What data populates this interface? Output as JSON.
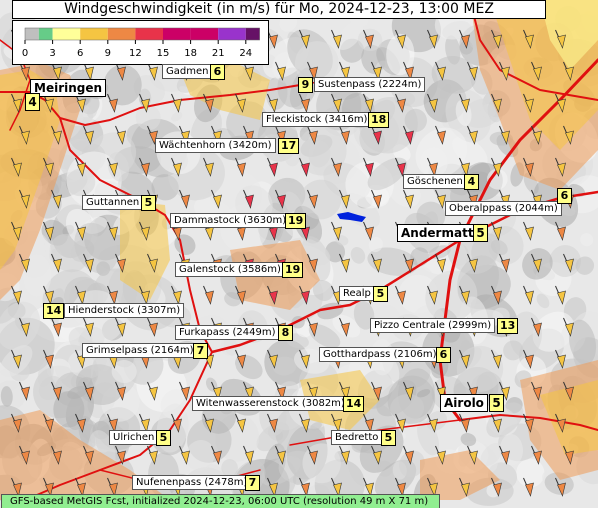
{
  "title": "Windgeschwindigkeit (in m/s) für Mo, 2024-12-23, 13:00 MEZ",
  "legend": {
    "ticks": [
      "0",
      "3",
      "6",
      "9",
      "12",
      "15",
      "18",
      "21",
      "24"
    ],
    "colors": [
      "#bfbfbf",
      "#66cc88",
      "#ffff99",
      "#f5c542",
      "#ee8844",
      "#e8334a",
      "#cc0066",
      "#9933cc",
      "#661166"
    ]
  },
  "places": [
    {
      "name": "Meiringen",
      "value": "4",
      "big": true
    },
    {
      "name": "Gadmen",
      "value": "6"
    },
    {
      "name": "Sustenpass (2224m)",
      "value": "9"
    },
    {
      "name": "Fleckistock (3416m)",
      "value": "18"
    },
    {
      "name": "Wächtenhorn (3420m)",
      "value": "17"
    },
    {
      "name": "Göschenen",
      "value": "4"
    },
    {
      "name": "Oberalppass (2044m)",
      "value": "6"
    },
    {
      "name": "Guttannen",
      "value": "5"
    },
    {
      "name": "Dammastock (3630m)",
      "value": "19"
    },
    {
      "name": "Andermatt",
      "value": "5",
      "big": true
    },
    {
      "name": "Galenstock (3586m)",
      "value": "19"
    },
    {
      "name": "Realp",
      "value": "5"
    },
    {
      "name": "Hienderstock (3307m)",
      "value": "14"
    },
    {
      "name": "Pizzo Centrale (2999m)",
      "value": "13"
    },
    {
      "name": "Furkapass (2449m)",
      "value": "8"
    },
    {
      "name": "Grimselpass (2164m)",
      "value": "7"
    },
    {
      "name": "Gotthardpass (2106m)",
      "value": "6"
    },
    {
      "name": "Airolo",
      "value": "5",
      "big": true
    },
    {
      "name": "Witenwasserenstock (3082m)",
      "value": "14"
    },
    {
      "name": "Ulrichen",
      "value": "5"
    },
    {
      "name": "Bedretto",
      "value": "5"
    },
    {
      "name": "Nufenenpass (2478m)",
      "value": "7"
    }
  ],
  "footer": "GFS-based MetGIS Fcst, initialized 2024-12-23, 06:00 UTC  (resolution 49 m X 71 m)"
}
